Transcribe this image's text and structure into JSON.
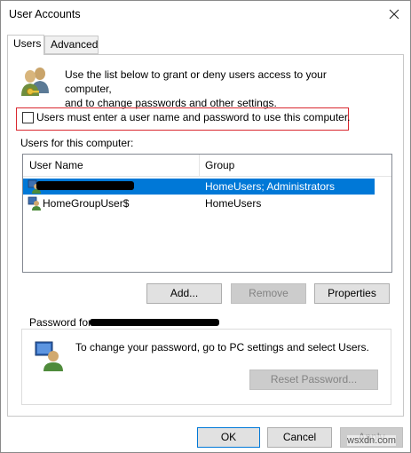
{
  "window": {
    "title": "User Accounts"
  },
  "tabs": [
    {
      "label": "Users",
      "active": true
    },
    {
      "label": "Advanced",
      "active": false
    }
  ],
  "intro": {
    "line1": "Use the list below to grant or deny users access to your computer,",
    "line2": "and to change passwords and other settings."
  },
  "login_required": {
    "label": "Users must enter a user name and password to use this computer.",
    "checked": false
  },
  "users_list": {
    "label": "Users for this computer:",
    "columns": [
      "User Name",
      "Group"
    ],
    "rows": [
      {
        "user_name": "",
        "group": "HomeUsers; Administrators",
        "selected": true,
        "redacted": true
      },
      {
        "user_name": "HomeGroupUser$",
        "group": "HomeUsers",
        "selected": false,
        "redacted": false
      }
    ]
  },
  "list_buttons": {
    "add": "Add...",
    "remove": "Remove",
    "properties": "Properties"
  },
  "password_group": {
    "title_prefix": "Password for",
    "text": "To change your password, go to PC settings and select Users.",
    "reset_button": "Reset Password..."
  },
  "dialog_buttons": {
    "ok": "OK",
    "cancel": "Cancel",
    "apply": "Apply"
  },
  "watermark": "wsxdn.com",
  "colors": {
    "selection": "#0078d7",
    "highlight_border": "#d9282f"
  }
}
